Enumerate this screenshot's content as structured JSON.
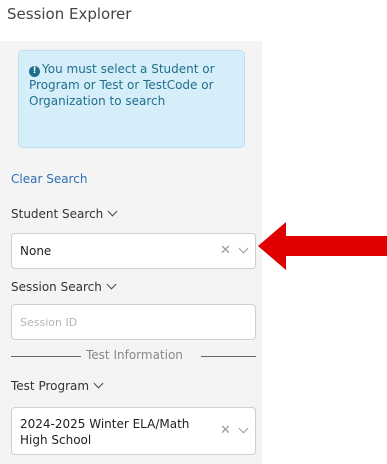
{
  "page": {
    "title": "Session Explorer"
  },
  "info": {
    "message": "You must select a Student or Program or Test or TestCode or Organization to search"
  },
  "clear_search": "Clear Search",
  "student_search": {
    "label": "Student Search",
    "value": "None"
  },
  "session_search": {
    "label": "Session Search",
    "placeholder": "Session ID"
  },
  "divider": {
    "label": "Test Information"
  },
  "test_program": {
    "label": "Test Program",
    "value_line1": "2024-2025 Winter ELA/Math",
    "value_line2": "High School"
  },
  "colors": {
    "arrow": "#e00000",
    "info_bg": "#d6eefa",
    "link": "#2c6db3"
  }
}
